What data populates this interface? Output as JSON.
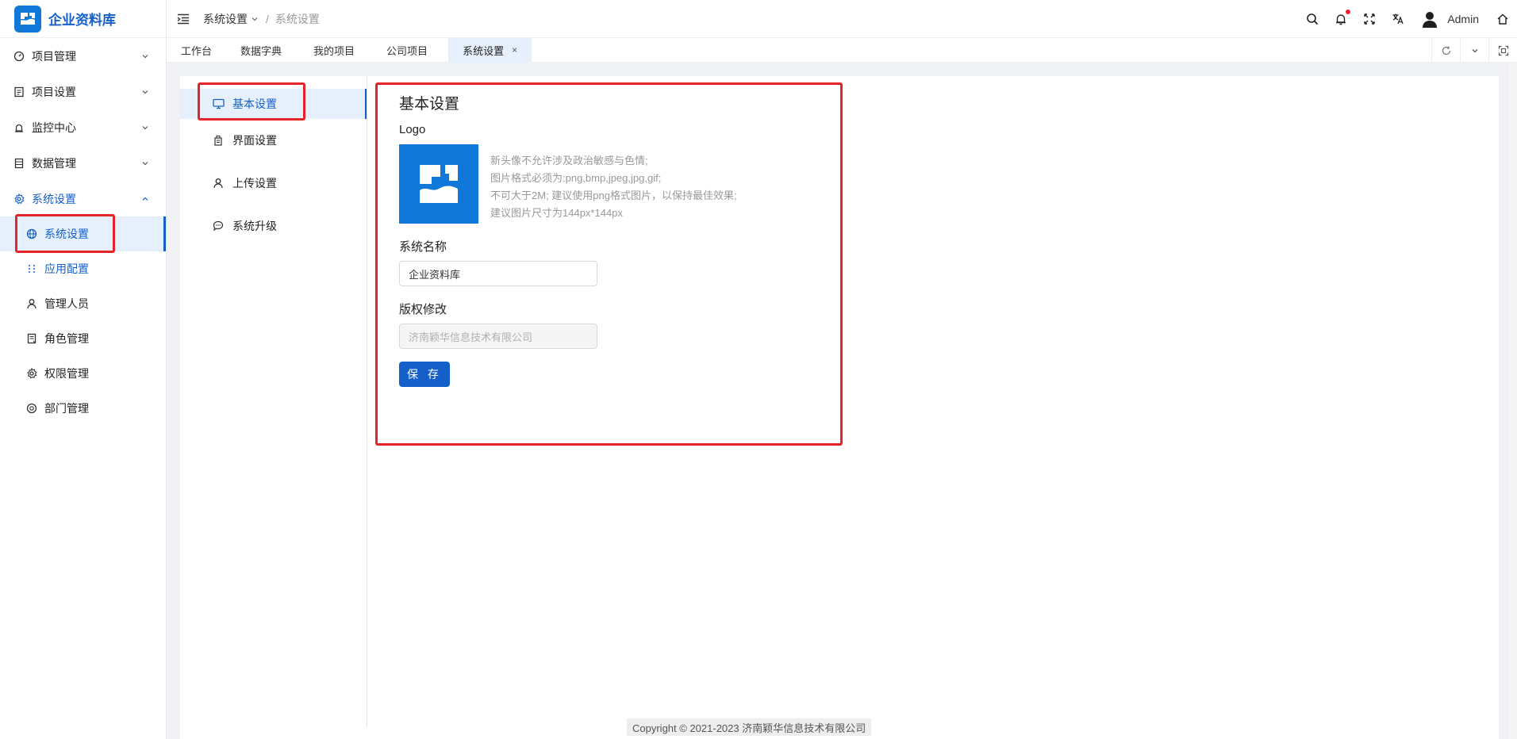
{
  "brand": {
    "title": "企业资料库"
  },
  "sidebar": {
    "groups": [
      {
        "label": "项目管理",
        "icon": "dashboard-icon"
      },
      {
        "label": "项目设置",
        "icon": "document-icon"
      },
      {
        "label": "监控中心",
        "icon": "alarm-icon"
      },
      {
        "label": "数据管理",
        "icon": "database-icon"
      },
      {
        "label": "系统设置",
        "icon": "gear-icon"
      }
    ],
    "sub_items": [
      {
        "label": "系统设置",
        "icon": "globe-icon"
      },
      {
        "label": "应用配置",
        "icon": "grid-dots-icon"
      },
      {
        "label": "管理人员",
        "icon": "user-icon"
      },
      {
        "label": "角色管理",
        "icon": "role-icon"
      },
      {
        "label": "权限管理",
        "icon": "gear-icon"
      },
      {
        "label": "部门管理",
        "icon": "department-icon"
      }
    ]
  },
  "header": {
    "breadcrumb": [
      "系统设置",
      "系统设置"
    ],
    "breadcrumb_sep": "/",
    "user": "Admin"
  },
  "tabs": [
    {
      "label": "工作台"
    },
    {
      "label": "数据字典"
    },
    {
      "label": "我的项目"
    },
    {
      "label": "公司项目"
    },
    {
      "label": "系统设置",
      "close": "×"
    }
  ],
  "submenu": [
    {
      "label": "基本设置",
      "icon": "monitor-icon"
    },
    {
      "label": "界面设置",
      "icon": "interface-icon"
    },
    {
      "label": "上传设置",
      "icon": "user-icon"
    },
    {
      "label": "系统升级",
      "icon": "chat-icon"
    }
  ],
  "form": {
    "title": "基本设置",
    "logo_label": "Logo",
    "hints": [
      "新头像不允许涉及政治敏感与色情;",
      "图片格式必须为:png,bmp,jpeg,jpg,gif;",
      "不可大于2M; 建议使用png格式图片，以保持最佳效果;",
      "建议图片尺寸为144px*144px"
    ],
    "name_label": "系统名称",
    "name_value": "企业资料库",
    "copyright_label": "版权修改",
    "copyright_placeholder": "济南颖华信息技术有限公司",
    "save_label": "保 存"
  },
  "footer": {
    "text": "Copyright © 2021-2023 济南颖华信息技术有限公司"
  },
  "colors": {
    "accent": "#1560c8",
    "brand": "#1078d8",
    "highlight": "#e5242a"
  }
}
